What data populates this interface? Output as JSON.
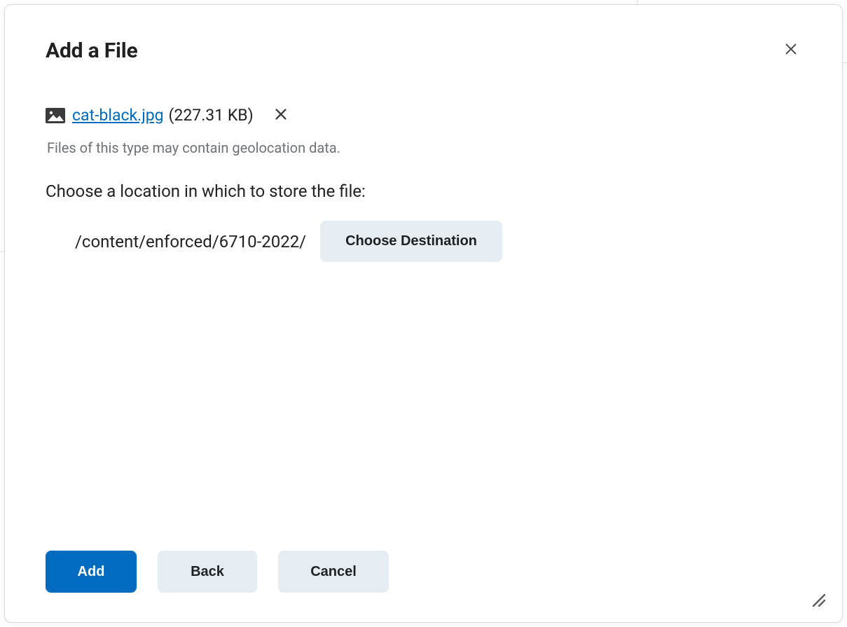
{
  "dialog": {
    "title": "Add a File",
    "file": {
      "name": "cat-black.jpg",
      "size": "(227.31 KB)"
    },
    "warning": "Files of this type may contain geolocation data.",
    "prompt": "Choose a location in which to store the file:",
    "location_path": "/content/enforced/6710-2022/",
    "choose_destination_label": "Choose Destination",
    "buttons": {
      "add": "Add",
      "back": "Back",
      "cancel": "Cancel"
    }
  }
}
